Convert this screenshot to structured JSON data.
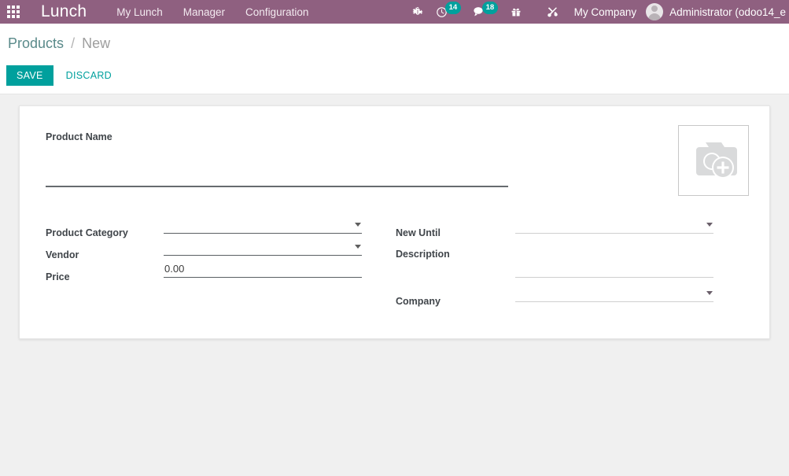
{
  "navbar": {
    "apps_icon": "apps-grid-icon",
    "brand": "Lunch",
    "menu": [
      {
        "label": "My Lunch"
      },
      {
        "label": "Manager"
      },
      {
        "label": "Configuration"
      }
    ],
    "icons": [
      {
        "name": "bug-icon",
        "badge": null
      },
      {
        "name": "activity-clock-icon",
        "badge": "14"
      },
      {
        "name": "messages-chat-icon",
        "badge": "18"
      },
      {
        "name": "gift-icon",
        "badge": null
      },
      {
        "name": "tools-icon",
        "badge": null
      }
    ],
    "company": "My Company",
    "user": "Administrator (odoo14_e",
    "bg_color": "#8f6080",
    "badge_color": "#00a09d"
  },
  "control_panel": {
    "breadcrumb_root": "Products",
    "breadcrumb_separator": "/",
    "breadcrumb_current": "New",
    "save_label": "SAVE",
    "discard_label": "DISCARD",
    "accent_color": "#00a09d"
  },
  "form": {
    "product_name": {
      "label": "Product Name",
      "value": "",
      "placeholder": ""
    },
    "image": {
      "name": "image-upload-placeholder",
      "icon": "camera-plus-icon"
    },
    "left_column": [
      {
        "label": "Product Category",
        "value": "",
        "type": "select"
      },
      {
        "label": "Vendor",
        "value": "",
        "type": "select"
      },
      {
        "label": "Price",
        "value": "0.00",
        "type": "text"
      }
    ],
    "right_column": [
      {
        "label": "New Until",
        "value": "",
        "type": "select"
      },
      {
        "label": "Description",
        "value": "",
        "type": "textarea"
      },
      {
        "label": "Company",
        "value": "",
        "type": "select"
      }
    ]
  }
}
